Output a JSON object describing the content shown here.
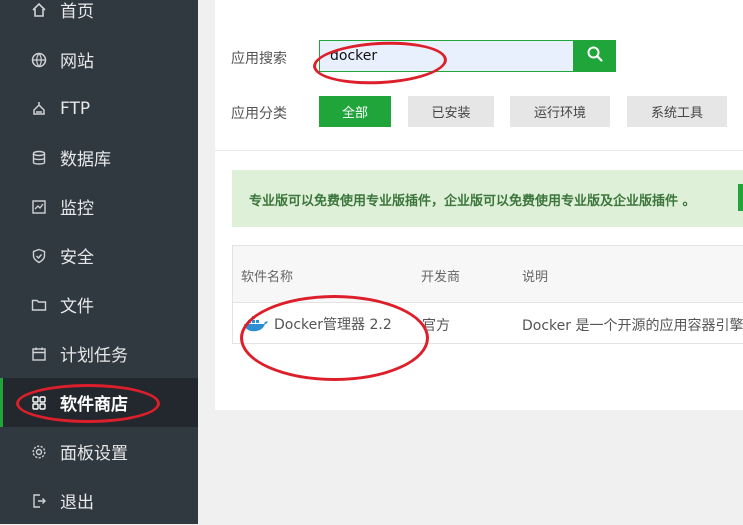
{
  "sidebar": {
    "items": [
      {
        "label": "首页",
        "icon": "home-icon"
      },
      {
        "label": "网站",
        "icon": "globe-icon"
      },
      {
        "label": "FTP",
        "icon": "ftp-icon"
      },
      {
        "label": "数据库",
        "icon": "database-icon"
      },
      {
        "label": "监控",
        "icon": "monitor-icon"
      },
      {
        "label": "安全",
        "icon": "shield-icon"
      },
      {
        "label": "文件",
        "icon": "folder-icon"
      },
      {
        "label": "计划任务",
        "icon": "calendar-icon"
      },
      {
        "label": "软件商店",
        "icon": "grid-icon",
        "active": true
      },
      {
        "label": "面板设置",
        "icon": "gear-icon"
      },
      {
        "label": "退出",
        "icon": "logout-icon"
      }
    ]
  },
  "search": {
    "label": "应用搜索",
    "value": "docker",
    "button_icon": "search-icon"
  },
  "category": {
    "label": "应用分类",
    "buttons": [
      "全部",
      "已安装",
      "运行环境",
      "系统工具"
    ],
    "active": "全部"
  },
  "notice": {
    "text": "专业版可以免费使用专业版插件，企业版可以免费使用专业版及企业版插件 。"
  },
  "table": {
    "headers": [
      "软件名称",
      "开发商",
      "说明"
    ],
    "rows": [
      {
        "name": "Docker管理器 2.2",
        "vendor": "官方",
        "desc": "Docker 是一个开源的应用容器引擎",
        "icon": "docker-whale-icon"
      }
    ]
  },
  "colors": {
    "sidebar_bg": "#313940",
    "accent": "#20a53a",
    "annotation": "#dc1f2a"
  }
}
